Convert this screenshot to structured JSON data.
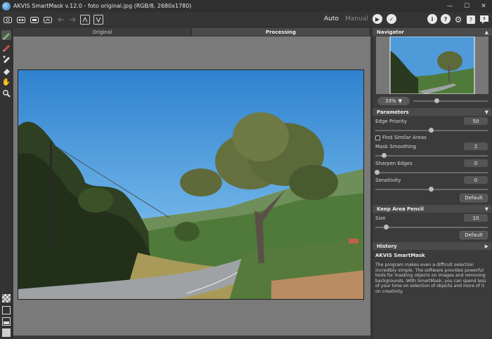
{
  "window": {
    "title": "AKVIS SmartMask v.12.0 - foto original.jpg (RGB/8, 2680x1780)",
    "minimize_glyph": "—",
    "maximize_glyph": "☐",
    "close_glyph": "✕"
  },
  "toolbar": {
    "mode_auto": "Auto",
    "mode_manual": "Manual",
    "icons": [
      "open-icon",
      "save-icon",
      "print-icon",
      "share-icon",
      "undo-icon",
      "redo-icon",
      "import-strokes-icon",
      "export-strokes-icon",
      "run-icon",
      "apply-icon",
      "info-icon",
      "help-icon",
      "settings-icon",
      "tips-icon",
      "feedback-icon"
    ]
  },
  "tabs": [
    "Original",
    "Processing"
  ],
  "active_tab": "Processing",
  "tools": [
    "keep-pencil-icon",
    "remove-pencil-icon",
    "magic-brush-icon",
    "eraser-icon",
    "hand-icon",
    "zoom-icon"
  ],
  "navigator": {
    "title": "Navigator",
    "zoom": "33%"
  },
  "parameters": {
    "title": "Parameters",
    "edge_priority": {
      "label": "Edge Priority",
      "value": "50",
      "fraction": 0.5
    },
    "find_similar": {
      "label": "Find Similar Areas",
      "checked": false
    },
    "mask_smoothing": {
      "label": "Mask Smoothing",
      "value": "2",
      "fraction": 0.08
    },
    "sharpen_edges": {
      "label": "Sharpen Edges",
      "value": "0",
      "fraction": 0.0
    },
    "sensitivity": {
      "label": "Sensitivity",
      "value": "0",
      "fraction": 0.5
    },
    "default_label": "Default"
  },
  "keep_area_pencil": {
    "title": "Keep Area Pencil",
    "size": {
      "label": "Size",
      "value": "10",
      "fraction": 0.1
    },
    "default_label": "Default"
  },
  "history": {
    "title": "History"
  },
  "help": {
    "title": "AKVIS SmartMask",
    "text": "The program makes even a difficult selection incredibly simple. The software provides powerful tools for masking objects on images and removing backgrounds. With SmartMask, you can spend less of your time on selection of objects and more of it on creativity."
  },
  "colors": {
    "accent": "#4a4a4a",
    "sky": "#4f9ad8",
    "hills": "#4f7a3a"
  }
}
